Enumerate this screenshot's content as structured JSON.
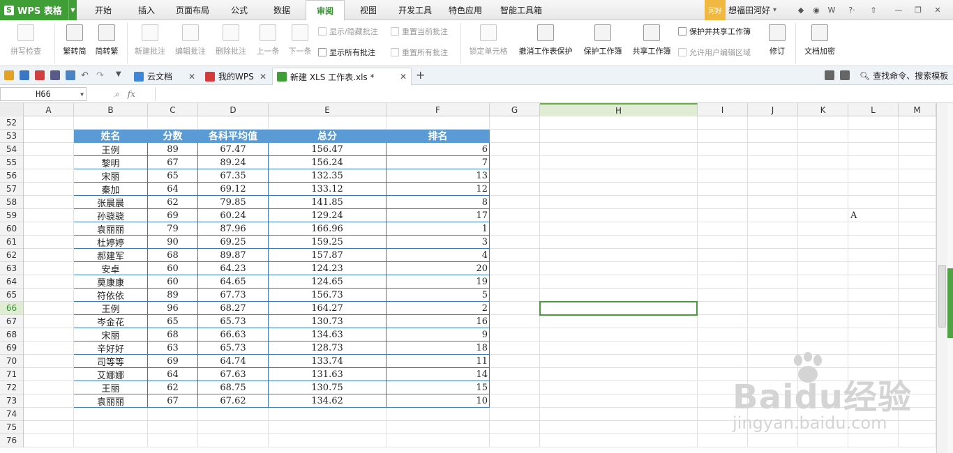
{
  "app": {
    "name": "WPS 表格",
    "badge": "河好",
    "user": "想福田河好"
  },
  "menu": {
    "tabs": [
      "开始",
      "插入",
      "页面布局",
      "公式",
      "数据",
      "审阅",
      "视图",
      "开发工具",
      "特色应用",
      "智能工具箱"
    ],
    "active": "审阅"
  },
  "ribbon": {
    "spell": "拼写检查",
    "to_trad": "繁转简",
    "to_simp": "简转繁",
    "new_comment": "新建批注",
    "edit_comment": "编辑批注",
    "delete_comment": "删除批注",
    "prev": "上一条",
    "next": "下一条",
    "show_hide_comment": "显示/隐藏批注",
    "reset_current_comment": "重置当前批注",
    "show_all_comments": "显示所有批注",
    "reset_all_comments": "重置所有批注",
    "lock_cells": "锁定单元格",
    "unprotect_sheet": "撤消工作表保护",
    "protect_workbook": "保护工作簿",
    "share_workbook": "共享工作簿",
    "protect_share_workbook": "保护并共享工作簿",
    "allow_edit_ranges": "允许用户编辑区域",
    "track_changes": "修订",
    "encrypt_doc": "文档加密"
  },
  "doc_tabs": [
    "云文档",
    "我的WPS",
    "新建 XLS 工作表.xls *"
  ],
  "search_cmd": "查找命令、搜索模板",
  "formula_bar": {
    "name_box": "H66",
    "fx": "fx",
    "content": ""
  },
  "columns": [
    "A",
    "B",
    "C",
    "D",
    "E",
    "F",
    "G",
    "H",
    "I",
    "J",
    "K",
    "L",
    "M"
  ],
  "selected_col": "H",
  "rows": [
    "52",
    "53",
    "54",
    "55",
    "56",
    "57",
    "58",
    "59",
    "60",
    "61",
    "62",
    "63",
    "64",
    "65",
    "66",
    "67",
    "68",
    "69",
    "70",
    "71",
    "72",
    "73",
    "74",
    "75",
    "76"
  ],
  "selected_row": "66",
  "table": {
    "headers": [
      "姓名",
      "分数",
      "各科平均值",
      "总分",
      "排名"
    ],
    "rows": [
      [
        "王例",
        "89",
        "67.47",
        "156.47",
        "6"
      ],
      [
        "黎明",
        "67",
        "89.24",
        "156.24",
        "7"
      ],
      [
        "宋丽",
        "65",
        "67.35",
        "132.35",
        "13"
      ],
      [
        "秦加",
        "64",
        "69.12",
        "133.12",
        "12"
      ],
      [
        "张晨晨",
        "62",
        "79.85",
        "141.85",
        "8"
      ],
      [
        "孙骁骁",
        "69",
        "60.24",
        "129.24",
        "17"
      ],
      [
        "袁丽丽",
        "79",
        "87.96",
        "166.96",
        "1"
      ],
      [
        "杜婷婷",
        "90",
        "69.25",
        "159.25",
        "3"
      ],
      [
        "郝建军",
        "68",
        "89.87",
        "157.87",
        "4"
      ],
      [
        "安卓",
        "60",
        "64.23",
        "124.23",
        "20"
      ],
      [
        "莫康康",
        "60",
        "64.65",
        "124.65",
        "19"
      ],
      [
        "符依依",
        "89",
        "67.73",
        "156.73",
        "5"
      ],
      [
        "王例",
        "96",
        "68.27",
        "164.27",
        "2"
      ],
      [
        "岑金花",
        "65",
        "65.73",
        "130.73",
        "16"
      ],
      [
        "宋丽",
        "68",
        "66.63",
        "134.63",
        "9"
      ],
      [
        "辛好好",
        "63",
        "65.73",
        "128.73",
        "18"
      ],
      [
        "司等等",
        "69",
        "64.74",
        "133.74",
        "11"
      ],
      [
        "艾娜娜",
        "64",
        "67.63",
        "131.63",
        "14"
      ],
      [
        "王丽",
        "62",
        "68.75",
        "130.75",
        "15"
      ],
      [
        "袁丽丽",
        "67",
        "67.62",
        "134.62",
        "10"
      ]
    ]
  },
  "cell_L59": "A",
  "watermark": {
    "brand": "Baidu经验",
    "url": "jingyan.baidu.com"
  },
  "colors": {
    "accent": "#3f9e35",
    "table_header": "#5b9bd5",
    "table_border": "#3a78b8",
    "selection": "#4b9b3c"
  }
}
